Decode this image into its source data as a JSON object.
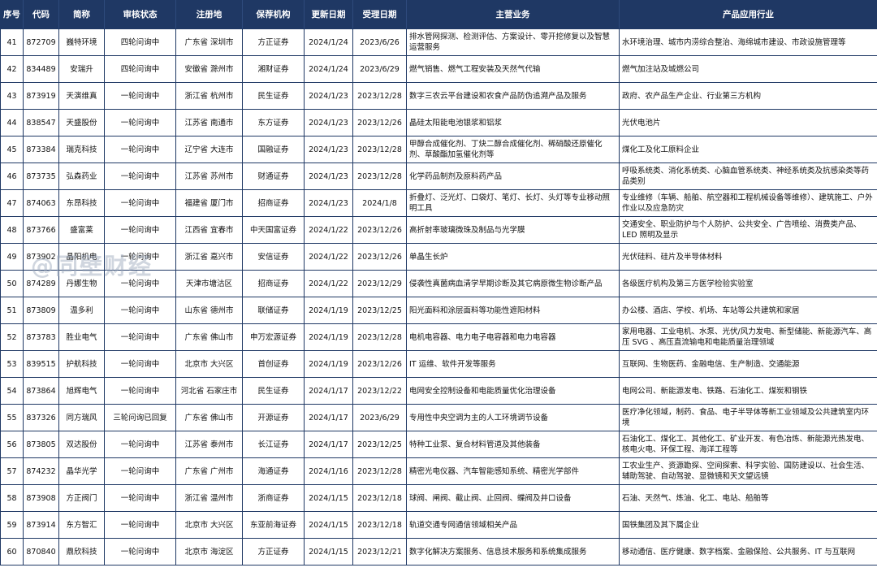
{
  "table": {
    "headers": [
      "序号",
      "代码",
      "简称",
      "审核状态",
      "注册地",
      "保荐机构",
      "更新日期",
      "受理日期",
      "主营业务",
      "产品应用行业"
    ],
    "rows": [
      [
        "41",
        "872709",
        "巍特环境",
        "四轮问询中",
        "广东省  深圳市",
        "方正证券",
        "2024/1/24",
        "2023/6/26",
        "排水管网探测、检测评估、方案设计、零开挖修复以及智慧运营服务",
        "水环境治理、城市内涝综合整治、海绵城市建设、市政设施管理等"
      ],
      [
        "42",
        "834489",
        "安瑞升",
        "四轮问询中",
        "安徽省  滁州市",
        "湘财证券",
        "2024/1/24",
        "2023/6/29",
        "燃气销售、燃气工程安装及天然气代输",
        "燃气加注站及城燃公司"
      ],
      [
        "43",
        "873919",
        "天演维真",
        "一轮问询中",
        "浙江省  杭州市",
        "民生证券",
        "2024/1/23",
        "2023/12/28",
        "数字三农云平台建设和农食产品防伪追溯产品及服务",
        "政府、农产品生产企业、行业第三方机构"
      ],
      [
        "44",
        "838547",
        "天盛股份",
        "一轮问询中",
        "江苏省  南通市",
        "东方证券",
        "2024/1/23",
        "2023/12/26",
        "晶硅太阳能电池银浆和铝浆",
        "光伏电池片"
      ],
      [
        "45",
        "873384",
        "瑞克科技",
        "一轮问询中",
        "辽宁省  大连市",
        "国融证券",
        "2024/1/23",
        "2023/12/28",
        "甲醇合成催化剂、丁炔二醇合成催化剂、稀硝酸还原催化剂、草酸酯加氢催化剂等",
        "煤化工及化工原料企业"
      ],
      [
        "46",
        "873735",
        "弘森药业",
        "一轮问询中",
        "江苏省  苏州市",
        "财通证券",
        "2024/1/23",
        "2023/12/28",
        "化学药品制剂及原料药产品",
        "呼吸系统类、消化系统类、心脑血管系统类、神经系统类及抗感染类等药品类别"
      ],
      [
        "47",
        "874063",
        "东昂科技",
        "一轮问询中",
        "福建省  厦门市",
        "招商证券",
        "2024/1/23",
        "2024/1/8",
        "折叠灯、泛光灯、口袋灯、笔灯、长灯、头灯等专业移动照明工具",
        "专业维修（车辆、船舶、航空器和工程机械设备等维修）、建筑施工、户外作业以及应急防灾"
      ],
      [
        "48",
        "873766",
        "盛富莱",
        "一轮问询中",
        "江西省  宜春市",
        "中天国富证券",
        "2024/1/22",
        "2023/12/26",
        "高折射率玻璃微珠及制品与光学膜",
        "交通安全、职业防护与个人防护、公共安全、广告喷绘、消费类产品、LED 照明及显示"
      ],
      [
        "49",
        "873902",
        "晶阳机电",
        "一轮问询中",
        "浙江省  嘉兴市",
        "安信证券",
        "2024/1/22",
        "2023/12/26",
        "单晶生长炉",
        "光伏硅料、硅片及半导体材料"
      ],
      [
        "50",
        "874289",
        "丹娜生物",
        "一轮问询中",
        "天津市塘沽区",
        "招商证券",
        "2024/1/22",
        "2023/12/29",
        "侵袭性真菌病血清学早期诊断及其它病原微生物诊断产品",
        "各级医疗机构及第三方医学检验实验室"
      ],
      [
        "51",
        "873809",
        "温多利",
        "一轮问询中",
        "山东省  德州市",
        "联储证券",
        "2024/1/19",
        "2023/12/25",
        "阳光面料和涂层面料等功能性遮阳材料",
        "办公楼、酒店、学校、机场、车站等公共建筑和家居"
      ],
      [
        "52",
        "873783",
        "胜业电气",
        "一轮问询中",
        "广东省  佛山市",
        "申万宏源证券",
        "2024/1/19",
        "2023/12/28",
        "电机电容器、电力电子电容器和电力电容器",
        "家用电器、工业电机、水泵、光伏/风力发电、新型储能、新能源汽车、高压 SVG 、高压直流输电和电能质量治理领域"
      ],
      [
        "53",
        "839515",
        "护航科技",
        "一轮问询中",
        "北京市  大兴区",
        "首创证券",
        "2024/1/19",
        "2023/12/26",
        "IT 运维、软件开发等服务",
        "互联网、生物医药、金融电信、生产制造、交通能源"
      ],
      [
        "54",
        "873864",
        "旭辉电气",
        "一轮问询中",
        "河北省  石家庄市",
        "民生证券",
        "2024/1/17",
        "2023/12/22",
        "电网安全控制设备和电能质量优化治理设备",
        "电网公司、新能源发电、铁路、石油化工、煤炭和钢铁"
      ],
      [
        "55",
        "837326",
        "同方瑞风",
        "三轮问询已回复",
        "广东省  佛山市",
        "开源证券",
        "2024/1/17",
        "2023/6/29",
        "专用性中央空调为主的人工环境调节设备",
        "医疗净化领域，制药、食品、电子半导体等新工业领域及公共建筑室内环境"
      ],
      [
        "56",
        "873805",
        "双达股份",
        "一轮问询中",
        "江苏省  泰州市",
        "长江证券",
        "2024/1/17",
        "2023/12/25",
        "特种工业泵、复合材料管道及其他装备",
        "石油化工、煤化工、其他化工、矿业开发、有色冶炼、新能源光热发电、核电火电、环保工程、海洋工程等"
      ],
      [
        "57",
        "874232",
        "晶华光学",
        "一轮问询中",
        "广东省  广州市",
        "海通证券",
        "2024/1/16",
        "2023/12/28",
        "精密光电仪器、汽车智能感知系统、精密光学部件",
        "工农业生产、资源勘探、空间探索、科学实验、国防建设以、社会生活、辅助驾驶、自动驾驶、显微镜和天文望远镜"
      ],
      [
        "58",
        "873908",
        "方正阀门",
        "一轮问询中",
        "浙江省  温州市",
        "浙商证券",
        "2024/1/15",
        "2023/12/18",
        "球阀、闸阀、截止阀、止回阀、蝶阀及井口设备",
        "石油、天然气、炼油、化工、电站、船舶等"
      ],
      [
        "59",
        "873914",
        "东方智汇",
        "一轮问询中",
        "北京市  大兴区",
        "东亚前海证券",
        "2024/1/15",
        "2023/12/18",
        "轨道交通专网通信领域相关产品",
        "国铁集团及其下属企业"
      ],
      [
        "60",
        "870840",
        "鼎欣科技",
        "一轮问询中",
        "北京市  海淀区",
        "方正证券",
        "2024/1/15",
        "2023/12/21",
        "数字化解决方案服务、信息技术服务和系统集成服务",
        "移动通信、医疗健康、数字档案、金融保险、公共服务、IT 与互联网"
      ]
    ]
  },
  "watermark": "@同壁财经"
}
